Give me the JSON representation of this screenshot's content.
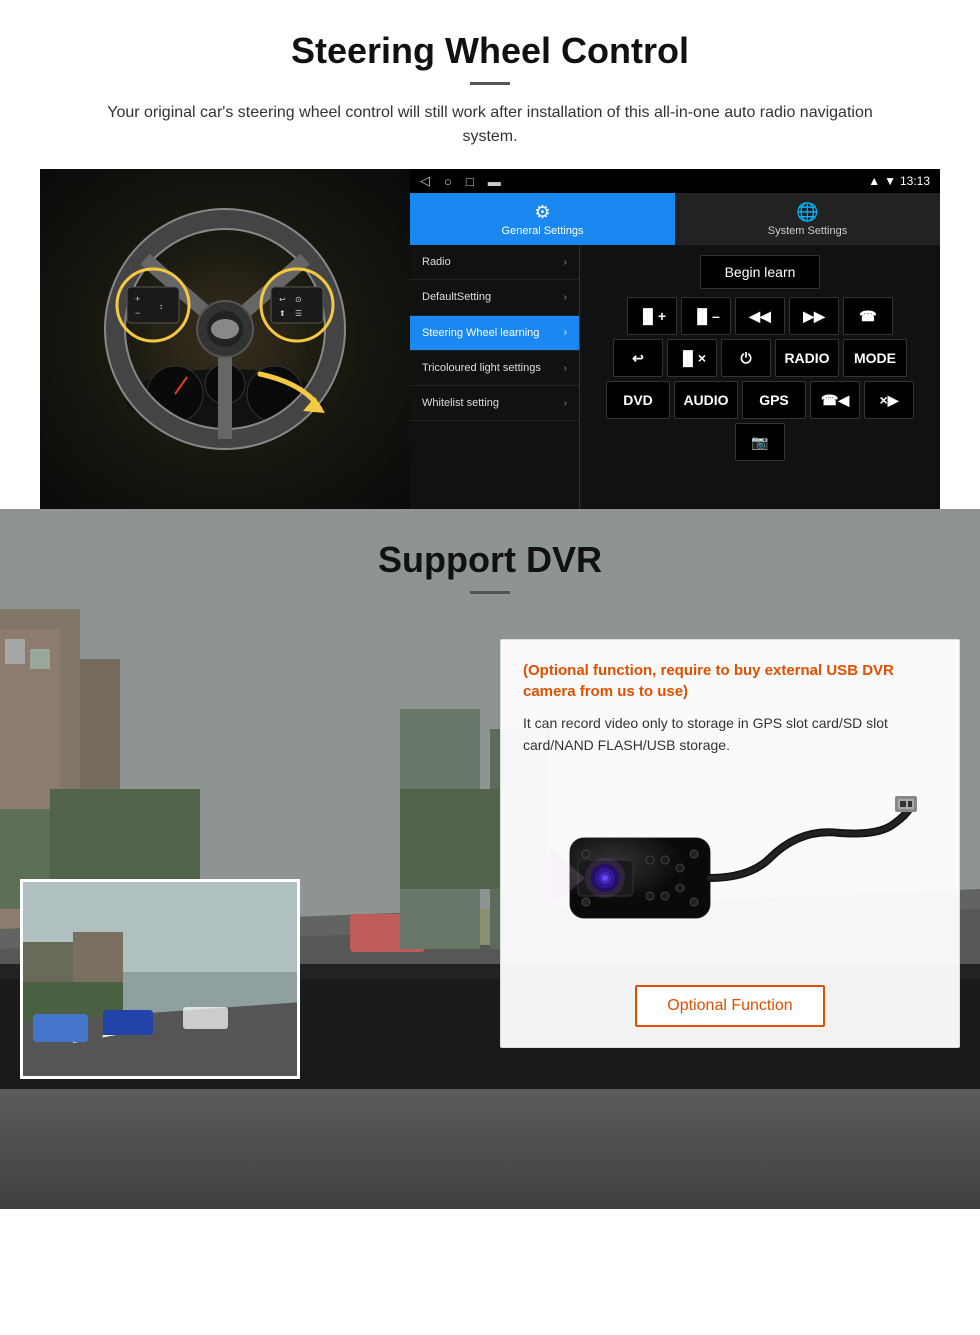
{
  "steering_section": {
    "title": "Steering Wheel Control",
    "subtitle": "Your original car's steering wheel control will still work after installation of this all-in-one auto radio navigation system.",
    "android_statusbar": {
      "nav_icons": [
        "◁",
        "○",
        "□",
        "▬"
      ],
      "time": "13:13",
      "signal_icons": [
        "▼",
        "▼"
      ]
    },
    "tabs": {
      "general": "General Settings",
      "system": "System Settings"
    },
    "menu_items": [
      {
        "label": "Radio",
        "active": false
      },
      {
        "label": "DefaultSetting",
        "active": false
      },
      {
        "label": "Steering Wheel learning",
        "active": true
      },
      {
        "label": "Tricoloured light settings",
        "active": false
      },
      {
        "label": "Whitelist setting",
        "active": false
      }
    ],
    "begin_learn_label": "Begin learn",
    "control_buttons": [
      [
        "▐▌+",
        "▐▌–",
        "◀◀",
        "▶▶",
        "☎"
      ],
      [
        "↩",
        "▐▌×",
        "⏻",
        "RADIO",
        "MODE"
      ],
      [
        "DVD",
        "AUDIO",
        "GPS",
        "☎◀◀",
        "×▶▶"
      ]
    ]
  },
  "dvr_section": {
    "title": "Support DVR",
    "optional_note": "(Optional function, require to buy external USB DVR camera from us to use)",
    "description": "It can record video only to storage in GPS slot card/SD slot card/NAND FLASH/USB storage.",
    "optional_button_label": "Optional Function"
  }
}
